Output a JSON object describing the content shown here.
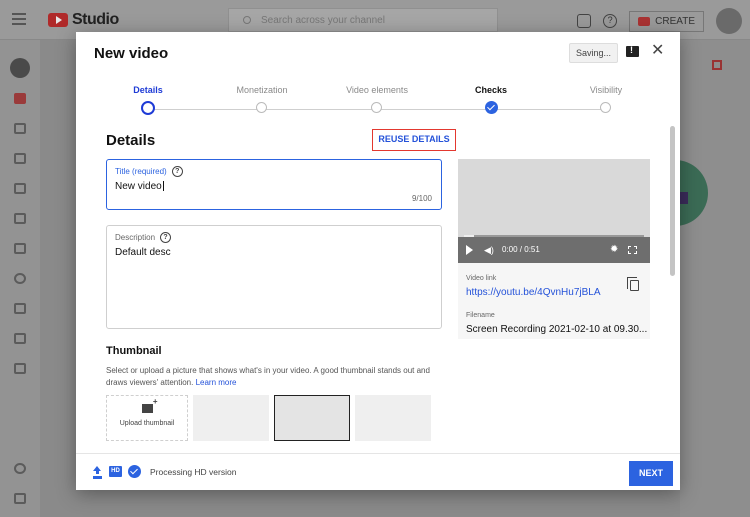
{
  "app": {
    "brand": "Studio",
    "search_placeholder": "Search across your channel",
    "create_label": "CREATE"
  },
  "modal": {
    "title": "New video",
    "saving_label": "Saving...",
    "steps": [
      {
        "label": "Details",
        "state": "active"
      },
      {
        "label": "Monetization",
        "state": "pending"
      },
      {
        "label": "Video elements",
        "state": "pending"
      },
      {
        "label": "Checks",
        "state": "done"
      },
      {
        "label": "Visibility",
        "state": "pending"
      }
    ],
    "section_title": "Details",
    "reuse_label": "REUSE DETAILS",
    "title_field": {
      "label": "Title (required)",
      "value": "New video",
      "count": "9/100"
    },
    "description_field": {
      "label": "Description",
      "value": "Default desc"
    },
    "thumbnail": {
      "title": "Thumbnail",
      "description": "Select or upload a picture that shows what's in your video. A good thumbnail stands out and draws viewers' attention.",
      "learn_more": "Learn more",
      "upload_label": "Upload thumbnail"
    },
    "preview": {
      "time": "0:00 / 0:51",
      "video_link_label": "Video link",
      "video_link": "https://youtu.be/4QvnHu7jBLA",
      "filename_label": "Filename",
      "filename": "Screen Recording 2021-02-10 at 09.30..."
    },
    "footer": {
      "hd_badge": "HD",
      "status": "Processing HD version",
      "next_label": "NEXT"
    }
  },
  "colors": {
    "accent": "#2c63e0",
    "highlight_box": "#e3382f"
  }
}
